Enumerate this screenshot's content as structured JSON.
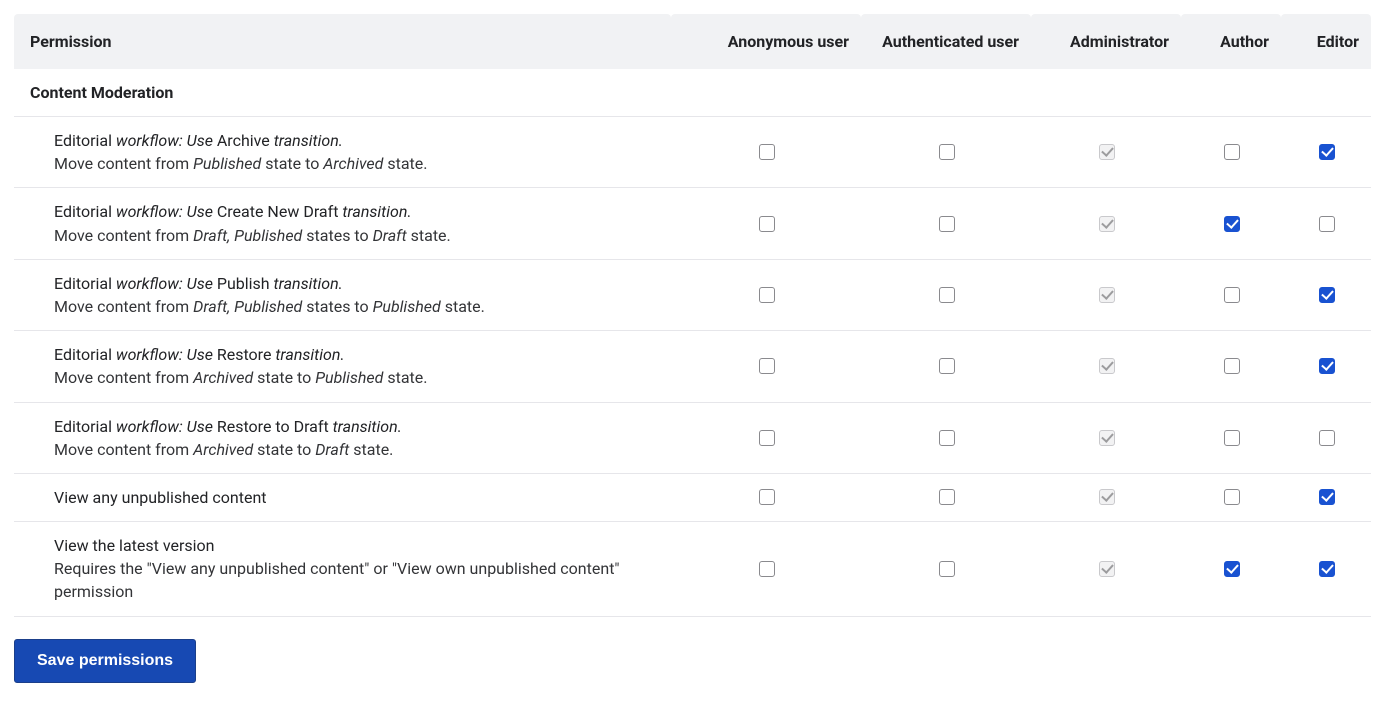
{
  "header": {
    "permission_label": "Permission",
    "roles": [
      "Anonymous user",
      "Authenticated user",
      "Administrator",
      "Author",
      "Editor"
    ]
  },
  "section_title": "Content Moderation",
  "rows": [
    {
      "title_parts": [
        "Editorial",
        " workflow: Use ",
        "Archive",
        " transition."
      ],
      "desc_parts": [
        "Move content from ",
        "Published",
        " state to ",
        "Archived",
        " state."
      ],
      "checks": [
        {
          "checked": false,
          "locked": false
        },
        {
          "checked": false,
          "locked": false
        },
        {
          "checked": true,
          "locked": true
        },
        {
          "checked": false,
          "locked": false
        },
        {
          "checked": true,
          "locked": false
        }
      ]
    },
    {
      "title_parts": [
        "Editorial",
        " workflow: Use ",
        "Create New Draft",
        " transition."
      ],
      "desc_parts": [
        "Move content from ",
        "Draft, Published",
        " states to ",
        "Draft",
        " state."
      ],
      "checks": [
        {
          "checked": false,
          "locked": false
        },
        {
          "checked": false,
          "locked": false
        },
        {
          "checked": true,
          "locked": true
        },
        {
          "checked": true,
          "locked": false
        },
        {
          "checked": false,
          "locked": false
        }
      ]
    },
    {
      "title_parts": [
        "Editorial",
        " workflow: Use ",
        "Publish",
        " transition."
      ],
      "desc_parts": [
        "Move content from ",
        "Draft, Published",
        " states to ",
        "Published",
        " state."
      ],
      "checks": [
        {
          "checked": false,
          "locked": false
        },
        {
          "checked": false,
          "locked": false
        },
        {
          "checked": true,
          "locked": true
        },
        {
          "checked": false,
          "locked": false
        },
        {
          "checked": true,
          "locked": false
        }
      ]
    },
    {
      "title_parts": [
        "Editorial",
        " workflow: Use ",
        "Restore",
        " transition."
      ],
      "desc_parts": [
        "Move content from ",
        "Archived",
        " state to ",
        "Published",
        " state."
      ],
      "checks": [
        {
          "checked": false,
          "locked": false
        },
        {
          "checked": false,
          "locked": false
        },
        {
          "checked": true,
          "locked": true
        },
        {
          "checked": false,
          "locked": false
        },
        {
          "checked": true,
          "locked": false
        }
      ]
    },
    {
      "title_parts": [
        "Editorial",
        " workflow: Use ",
        "Restore to Draft",
        " transition."
      ],
      "desc_parts": [
        "Move content from ",
        "Archived",
        " state to ",
        "Draft",
        " state."
      ],
      "checks": [
        {
          "checked": false,
          "locked": false
        },
        {
          "checked": false,
          "locked": false
        },
        {
          "checked": true,
          "locked": true
        },
        {
          "checked": false,
          "locked": false
        },
        {
          "checked": false,
          "locked": false
        }
      ]
    },
    {
      "title_plain": "View any unpublished content",
      "checks": [
        {
          "checked": false,
          "locked": false
        },
        {
          "checked": false,
          "locked": false
        },
        {
          "checked": true,
          "locked": true
        },
        {
          "checked": false,
          "locked": false
        },
        {
          "checked": true,
          "locked": false
        }
      ]
    },
    {
      "title_plain": "View the latest version",
      "desc_plain": "Requires the \"View any unpublished content\" or \"View own unpublished content\" permission",
      "checks": [
        {
          "checked": false,
          "locked": false
        },
        {
          "checked": false,
          "locked": false
        },
        {
          "checked": true,
          "locked": true
        },
        {
          "checked": true,
          "locked": false
        },
        {
          "checked": true,
          "locked": false
        }
      ]
    }
  ],
  "save_label": "Save permissions"
}
